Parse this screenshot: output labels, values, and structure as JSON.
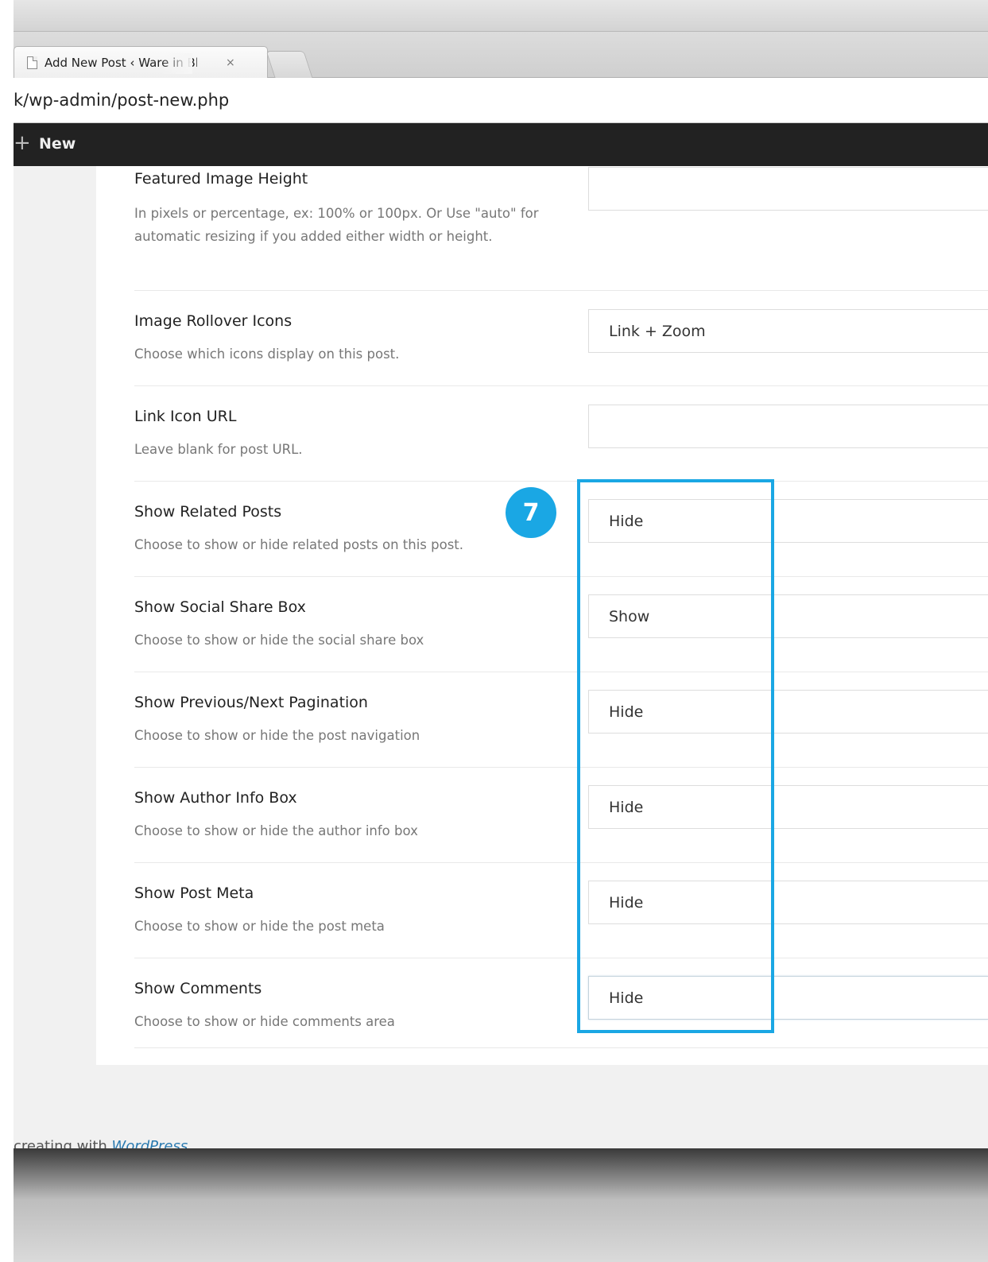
{
  "browser": {
    "tab_title": "Add New Post ‹ Ware in Blo",
    "tab_close": "×",
    "url": "k/wp-admin/post-new.php"
  },
  "adminbar": {
    "new_icon": "+",
    "new_label": "New"
  },
  "settings": [
    {
      "label": "Featured Image Height",
      "description": "In pixels or percentage, ex: 100% or 100px. Or Use \"auto\" for automatic resizing if you added either width or height.",
      "value": "",
      "control": "text-input"
    },
    {
      "label": "Image Rollover Icons",
      "description": "Choose which icons display on this post.",
      "value": "Link + Zoom",
      "control": "select"
    },
    {
      "label": "Link Icon URL",
      "description": "Leave blank for post URL.",
      "value": "",
      "control": "text-input"
    },
    {
      "label": "Show Related Posts",
      "description": "Choose to show or hide related posts on this post.",
      "value": "Hide",
      "control": "select"
    },
    {
      "label": "Show Social Share Box",
      "description": "Choose to show or hide the social share box",
      "value": "Show",
      "control": "select"
    },
    {
      "label": "Show Previous/Next Pagination",
      "description": "Choose to show or hide the post navigation",
      "value": "Hide",
      "control": "select"
    },
    {
      "label": "Show Author Info Box",
      "description": "Choose to show or hide the author info box",
      "value": "Hide",
      "control": "select"
    },
    {
      "label": "Show Post Meta",
      "description": "Choose to show or hide the post meta",
      "value": "Hide",
      "control": "select"
    },
    {
      "label": "Show Comments",
      "description": "Choose to show or hide comments area",
      "value": "Hide",
      "control": "select"
    }
  ],
  "annotation": {
    "step_number": "7",
    "color": "#1aa7e4"
  },
  "footer": {
    "text_prefix": "creating with ",
    "link_text": "WordPress"
  },
  "colors": {
    "adminbar": "#222222",
    "admin_background": "#f1f1f1",
    "description_text": "#777777"
  }
}
